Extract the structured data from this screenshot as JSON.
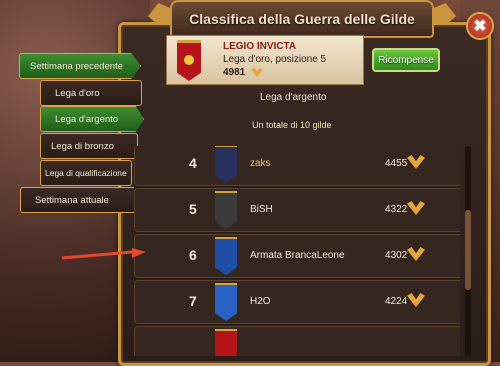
{
  "header": {
    "title": "Classifica della Guerra delle Gilde",
    "close_label": "✖"
  },
  "guild_card": {
    "name": "LEGIO INVICTA",
    "rank_text": "Lega d'oro, posizione 5",
    "score": "4981",
    "flag_color": "#b5141b"
  },
  "rewards_button": "Ricompense",
  "league_title": "Lega d'argento",
  "guild_count": "Un totale di 10 gilde",
  "tabs": [
    {
      "label": "Settimana precedente",
      "style": "green"
    },
    {
      "label": "Lega d'oro",
      "style": "dark"
    },
    {
      "label": "Lega d'argento",
      "style": "green"
    },
    {
      "label": "Lega di bronzo",
      "style": "dark"
    },
    {
      "label": "Lega di qualificazione",
      "style": "dark"
    },
    {
      "label": "Settimana attuale",
      "style": "dark"
    }
  ],
  "rows": [
    {
      "rank": "4",
      "name": "zaks",
      "score": "4455",
      "flag": "#27305f",
      "emblem": "#c23a2a",
      "name_color": "gold"
    },
    {
      "rank": "5",
      "name": "BiSH",
      "score": "4322",
      "flag": "#3b3b3b",
      "emblem": "#d9d9d9",
      "name_color": "normal"
    },
    {
      "rank": "6",
      "name": "Armata BrancaLeone",
      "score": "4302",
      "flag": "#1f4fa8",
      "emblem": "#e8e8e8",
      "name_color": "normal"
    },
    {
      "rank": "7",
      "name": "H2O",
      "score": "4224",
      "flag": "#2b61c2",
      "emblem": "#f3e2a0",
      "name_color": "normal"
    }
  ]
}
